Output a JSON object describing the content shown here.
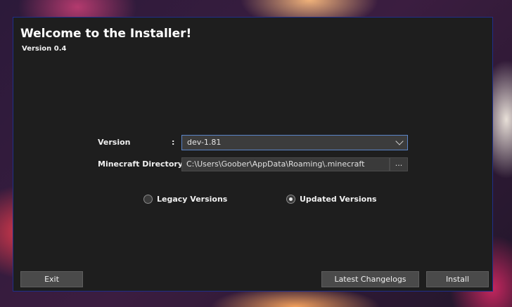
{
  "window": {
    "title": "Welcome to the Installer!",
    "version_text": "Version 0.4"
  },
  "form": {
    "version_label": "Version",
    "version_colon": ":",
    "version_selected": "dev-1.81",
    "directory_label": "Minecraft Directory :",
    "directory_value": "C:\\Users\\Goober\\AppData\\Roaming\\.minecraft",
    "browse_label": "..."
  },
  "radios": {
    "legacy_label": "Legacy Versions",
    "legacy_checked": false,
    "updated_label": "Updated Versions",
    "updated_checked": true
  },
  "buttons": {
    "exit_label": "Exit",
    "changelogs_label": "Latest Changelogs",
    "install_label": "Install"
  },
  "colors": {
    "window_bg": "#1e1e1e",
    "window_border": "#1f2f8a",
    "select_border": "#5a84c8",
    "button_bg": "#4a4a4a"
  },
  "icons": {
    "dropdown": "chevron-down-icon"
  }
}
